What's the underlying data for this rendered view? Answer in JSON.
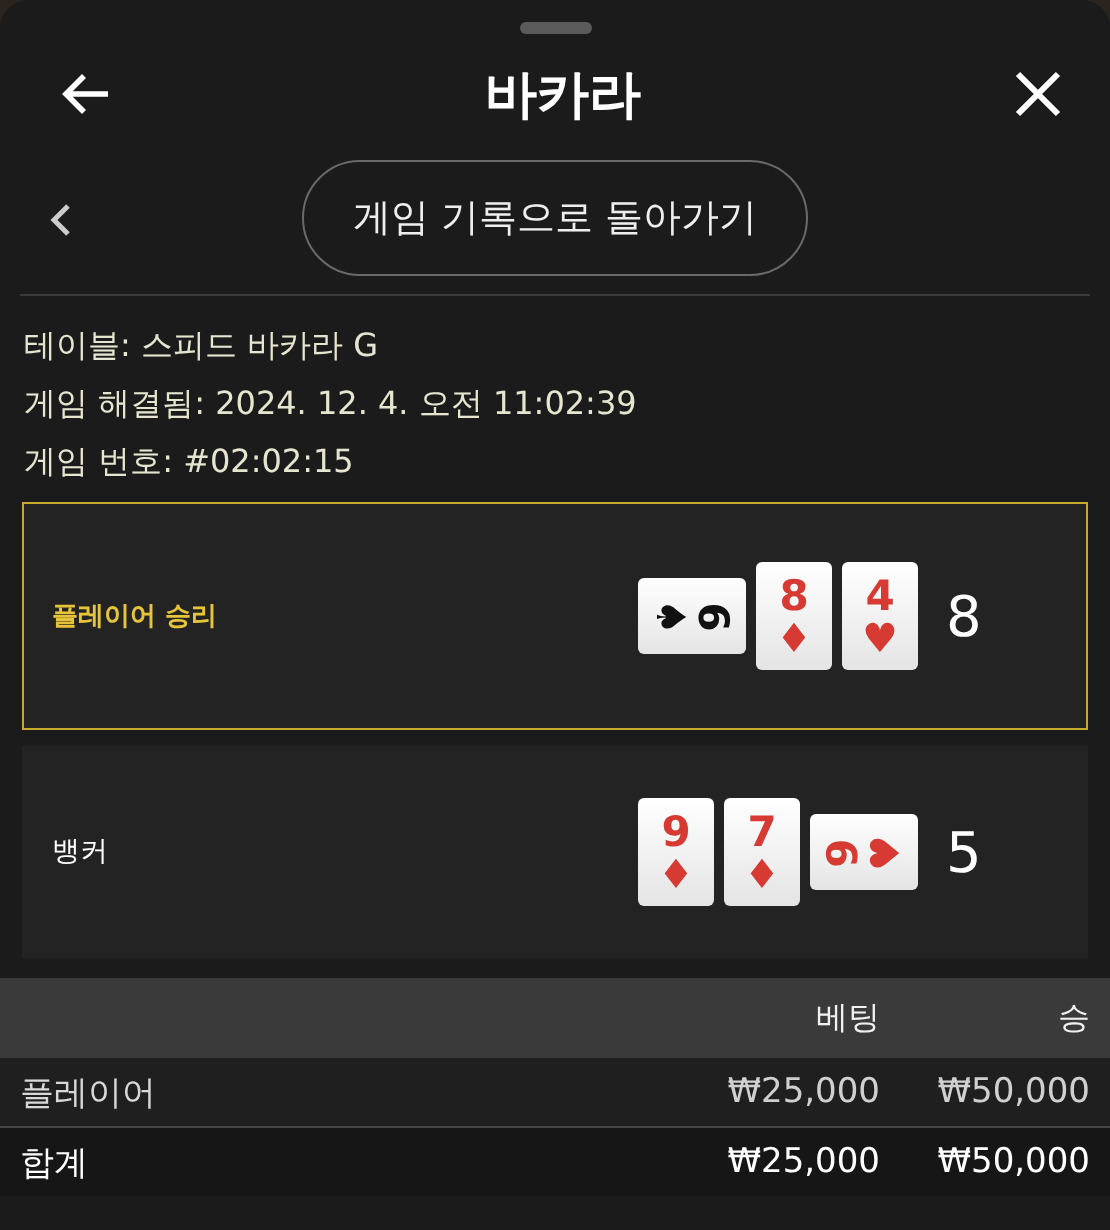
{
  "header": {
    "title": "바카라"
  },
  "back_link": {
    "label": "게임 기록으로 돌아가기"
  },
  "info": [
    {
      "label": "테이블:",
      "value": "스피드 바카라 G"
    },
    {
      "label": "게임 해결됨:",
      "value": "2024. 12. 4. 오전 11:02:39"
    },
    {
      "label": "게임 번호:",
      "value": "#02:02:15"
    }
  ],
  "hands": [
    {
      "label": "플레이어 승리",
      "winner": true,
      "score": "8",
      "cards": [
        {
          "kind": "rightward",
          "rank": "6",
          "suit": "♠",
          "color": "#111111"
        },
        {
          "kind": "upright",
          "rank": "8",
          "suit": "♦",
          "color": "#d63a32"
        },
        {
          "kind": "upright",
          "rank": "4",
          "suit": "♥",
          "color": "#d63a32"
        }
      ]
    },
    {
      "label": "뱅커",
      "winner": false,
      "score": "5",
      "cards": [
        {
          "kind": "upright",
          "rank": "9",
          "suit": "♦",
          "color": "#d63a32"
        },
        {
          "kind": "upright",
          "rank": "7",
          "suit": "♦",
          "color": "#d63a32"
        },
        {
          "kind": "leftward",
          "rank": "9",
          "suit": "♥",
          "color": "#d63a32"
        }
      ]
    }
  ],
  "bets_table": {
    "columns": [
      "베팅",
      "승"
    ],
    "rows": [
      {
        "kind": "bet",
        "label": "플레이어",
        "bet": "₩25,000",
        "win": "₩50,000"
      },
      {
        "kind": "total",
        "label": "합계",
        "bet": "₩25,000",
        "win": "₩50,000"
      }
    ]
  }
}
